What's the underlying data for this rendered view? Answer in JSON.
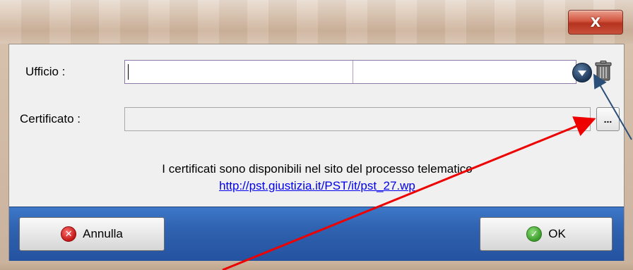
{
  "window": {
    "close_glyph": "X",
    "title_color": "#d8c3b0",
    "close_color": "#c9503b"
  },
  "form": {
    "ufficio_label": "Ufficio :",
    "ufficio_value": "",
    "certificato_label": "Certificato :",
    "certificato_value": "",
    "browse_label": "..."
  },
  "info": {
    "text": "I certificati sono disponibili nel sito del processo telematico",
    "link": "http://pst.giustizia.it/PST/it/pst_27.wp"
  },
  "buttons": {
    "cancel_label": "Annulla",
    "cancel_icon": "x-circle-icon",
    "ok_label": "OK",
    "ok_icon": "check-circle-icon",
    "bar_color": "#2f62b0"
  },
  "annotations": {
    "red_arrow_color": "#ee0000",
    "blue_arrow_color": "#2a4f79"
  }
}
